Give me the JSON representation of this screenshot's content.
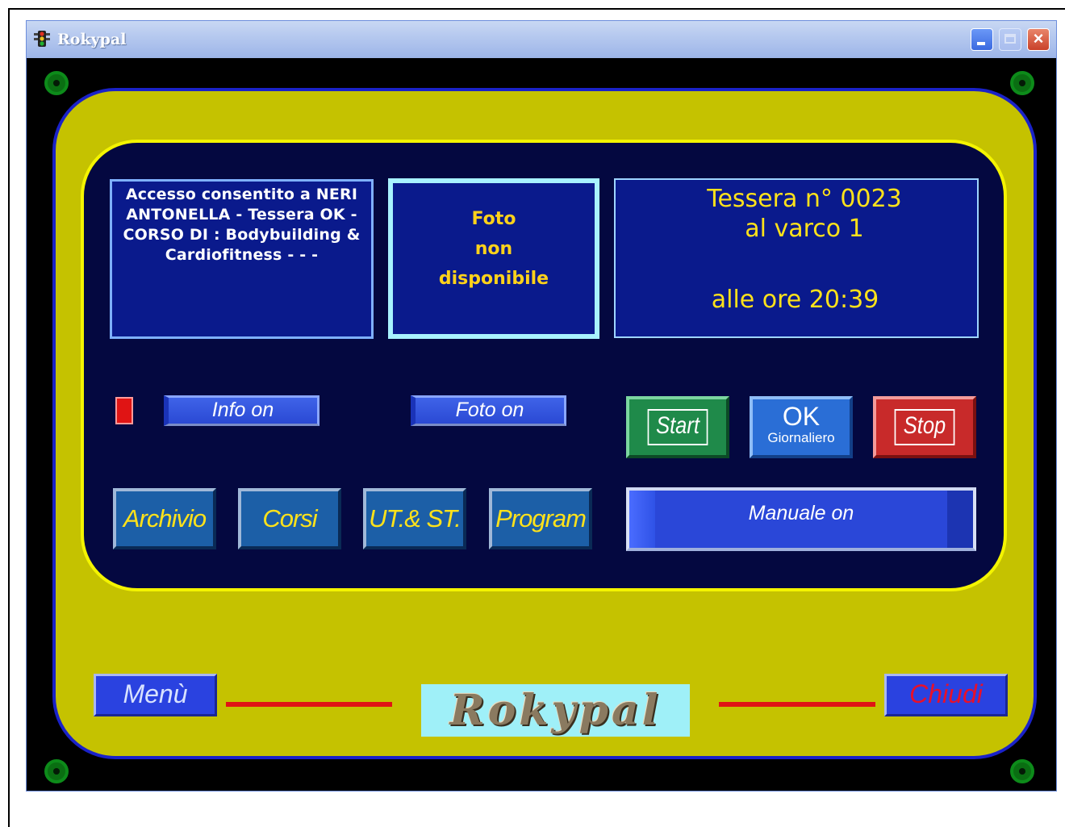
{
  "window": {
    "title": "Rokypal",
    "controls": [
      "minimize",
      "maximize",
      "close"
    ]
  },
  "display": {
    "access_message": "Accesso consentito a NERI ANTONELLA - Tessera OK - CORSO DI : Bodybuilding & Cardiofitness - - -",
    "photo": {
      "line1": "Foto",
      "line2": "non",
      "line3": "disponibile"
    },
    "tessera": {
      "line1": "Tessera n° 0023",
      "line2": "al varco 1",
      "line3": "alle ore 20:39"
    }
  },
  "toggles": {
    "info": "Info on",
    "foto": "Foto on",
    "manuale": "Manuale on"
  },
  "controls": {
    "start": "Start",
    "ok_main": "OK",
    "ok_sub": "Giornaliero",
    "stop": "Stop"
  },
  "nav": {
    "archivio": "Archivio",
    "corsi": "Corsi",
    "ut_st": "UT.& ST.",
    "program": "Program"
  },
  "footer": {
    "menu": "Menù",
    "logo": "Rokypal",
    "chiudi": "Chiudi"
  },
  "colors": {
    "panel_yellow": "#c5c200",
    "inner_navy": "#040840",
    "indicator_red": "#e01414",
    "text_yellow": "#ffe21a"
  }
}
